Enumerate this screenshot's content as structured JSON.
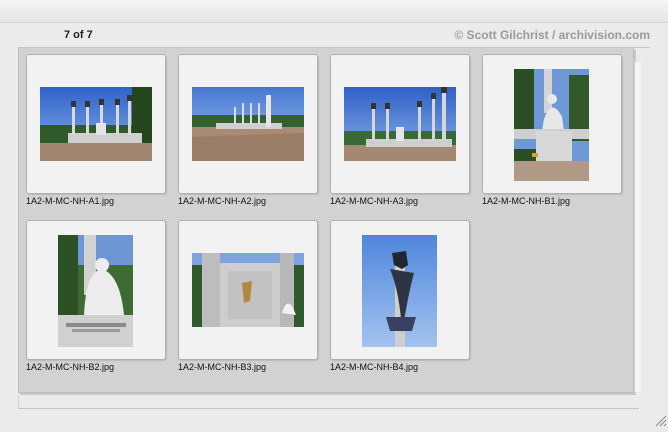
{
  "gallery": {
    "counter": "7 of 7",
    "copyright": "© Scott Gilchrist / archivision.com",
    "items": [
      {
        "filename": "1A2-M-MC-NH-A1.jpg"
      },
      {
        "filename": "1A2-M-MC-NH-A2.jpg"
      },
      {
        "filename": "1A2-M-MC-NH-A3.jpg"
      },
      {
        "filename": "1A2-M-MC-NH-B1.jpg"
      },
      {
        "filename": "1A2-M-MC-NH-B2.jpg"
      },
      {
        "filename": "1A2-M-MC-NH-B3.jpg"
      },
      {
        "filename": "1A2-M-MC-NH-B4.jpg"
      }
    ]
  }
}
